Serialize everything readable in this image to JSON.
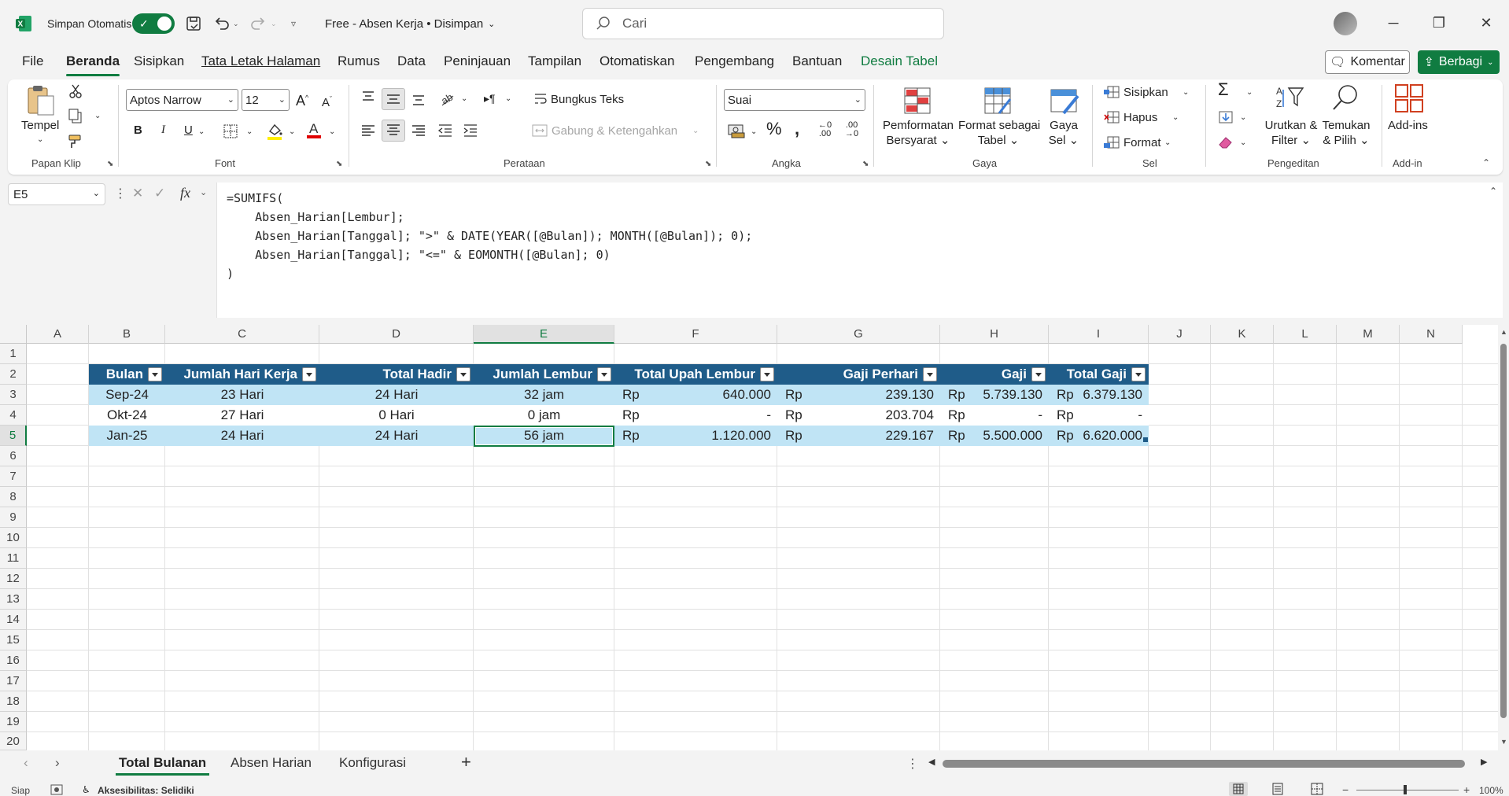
{
  "titlebar": {
    "autosave_label": "Simpan Otomatis",
    "doc_title": "Free - Absen Kerja • Disimpan",
    "search_placeholder": "Cari"
  },
  "menu": {
    "tabs": [
      "File",
      "Beranda",
      "Sisipkan",
      "Tata Letak Halaman",
      "Rumus",
      "Data",
      "Peninjauan",
      "Tampilan",
      "Otomatiskan",
      "Pengembang",
      "Bantuan",
      "Desain Tabel"
    ],
    "active": "Beranda",
    "comment_label": "Komentar",
    "share_label": "Berbagi"
  },
  "ribbon": {
    "clipboard": {
      "paste_label": "Tempel",
      "group_label": "Papan Klip"
    },
    "font": {
      "font_name": "Aptos Narrow",
      "font_size": "12",
      "bold": "B",
      "italic": "I",
      "underline": "U",
      "group_label": "Font"
    },
    "alignment": {
      "wrap_label": "Bungkus Teks",
      "merge_label": "Gabung & Ketengahkan",
      "group_label": "Perataan"
    },
    "number": {
      "format": "Suai",
      "group_label": "Angka"
    },
    "styles": {
      "cond_format_line1": "Pemformatan",
      "cond_format_line2": "Bersyarat",
      "format_table_line1": "Format sebagai",
      "format_table_line2": "Tabel",
      "cell_styles_line1": "Gaya",
      "cell_styles_line2": "Sel",
      "group_label": "Gaya"
    },
    "cells": {
      "insert_label": "Sisipkan",
      "delete_label": "Hapus",
      "format_label": "Format",
      "group_label": "Sel"
    },
    "editing": {
      "sort_line1": "Urutkan &",
      "sort_line2": "Filter",
      "find_line1": "Temukan",
      "find_line2": "& Pilih",
      "group_label": "Pengeditan"
    },
    "addins": {
      "label": "Add-ins",
      "group_label": "Add-in"
    }
  },
  "formula_bar": {
    "name_box": "E5",
    "fx": "fx",
    "formula": "=SUMIFS(\n    Absen_Harian[Lembur];\n    Absen_Harian[Tanggal]; \">\" & DATE(YEAR([@Bulan]); MONTH([@Bulan]); 0);\n    Absen_Harian[Tanggal]; \"<=\" & EOMONTH([@Bulan]; 0)\n)"
  },
  "grid": {
    "columns": [
      "A",
      "B",
      "C",
      "D",
      "E",
      "F",
      "G",
      "H",
      "I",
      "J",
      "K",
      "L",
      "M",
      "N"
    ],
    "rows": [
      "1",
      "2",
      "3",
      "4",
      "5",
      "6",
      "7",
      "8",
      "9",
      "10",
      "11",
      "12",
      "13",
      "14",
      "15",
      "16",
      "17",
      "18",
      "19",
      "20"
    ],
    "selected_cell": "E5"
  },
  "table": {
    "headers": [
      "Bulan",
      "Jumlah Hari Kerja",
      "Total Hadir",
      "Jumlah Lembur",
      "Total Upah Lembur",
      "Gaji Perhari",
      "Gaji",
      "Total Gaji"
    ],
    "rows": [
      {
        "bulan": "Sep-24",
        "hari_kerja": "23 Hari",
        "hadir": "24 Hari",
        "lembur": "32 jam",
        "upah_cur": "Rp",
        "upah": "640.000",
        "perhari_cur": "Rp",
        "perhari": "239.130",
        "gaji_cur": "Rp",
        "gaji": "5.739.130",
        "total_cur": "Rp",
        "total": "6.379.130"
      },
      {
        "bulan": "Okt-24",
        "hari_kerja": "27 Hari",
        "hadir": "0 Hari",
        "lembur": "0 jam",
        "upah_cur": "Rp",
        "upah": "-",
        "perhari_cur": "Rp",
        "perhari": "203.704",
        "gaji_cur": "Rp",
        "gaji": "-",
        "total_cur": "Rp",
        "total": "-"
      },
      {
        "bulan": "Jan-25",
        "hari_kerja": "24 Hari",
        "hadir": "24 Hari",
        "lembur": "56 jam",
        "upah_cur": "Rp",
        "upah": "1.120.000",
        "perhari_cur": "Rp",
        "perhari": "229.167",
        "gaji_cur": "Rp",
        "gaji": "5.500.000",
        "total_cur": "Rp",
        "total": "6.620.000"
      }
    ]
  },
  "sheets": {
    "tabs": [
      "Total Bulanan",
      "Absen Harian",
      "Konfigurasi"
    ],
    "active": "Total Bulanan",
    "add": "+"
  },
  "status": {
    "ready": "Siap",
    "accessibility": "Aksesibilitas: Selidiki",
    "zoom": "100%"
  },
  "colors": {
    "accent": "#107c41",
    "table_header": "#1f5c89",
    "band": "#c0e4f5"
  }
}
